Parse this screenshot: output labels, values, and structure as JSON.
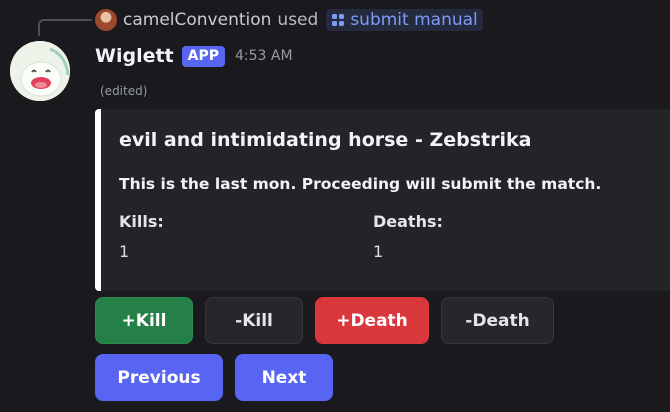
{
  "reply": {
    "username": "camelConvention",
    "used_text": "used",
    "command": "submit manual"
  },
  "message": {
    "author": "Wiglett",
    "badge": "APP",
    "timestamp": "4:53 AM",
    "edited": "(edited)"
  },
  "embed": {
    "accent_color": "#ffffff",
    "title": "evil and intimidating horse - Zebstrika",
    "description": "This is the last mon. Proceeding will submit the match.",
    "fields": [
      {
        "name": "Kills:",
        "value": "1"
      },
      {
        "name": "Deaths:",
        "value": "1"
      }
    ]
  },
  "buttons": {
    "row1": [
      "+Kill",
      "-Kill",
      "+Death",
      "-Death"
    ],
    "row2": [
      "Previous",
      "Next"
    ]
  },
  "colors": {
    "success": "#248046",
    "danger": "#da373c",
    "primary": "#5865f2",
    "secondary": "#26272b"
  }
}
